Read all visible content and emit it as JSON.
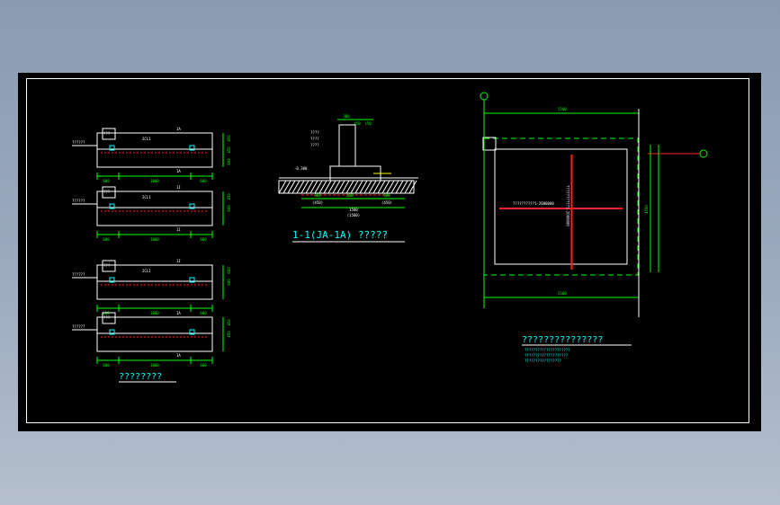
{
  "colors": {
    "background": "#000000",
    "line": "#ffffff",
    "dim": "#00ff00",
    "label": "#00ffff",
    "rebar": "#ff2020",
    "accent": "#ffff00"
  },
  "beams": [
    {
      "label_left": "??????",
      "tag_top": "???",
      "tag_mid": "2CL1",
      "axis_top": "1A",
      "axis_bottom": "1A",
      "dims_right": [
        "450",
        "450",
        "600"
      ],
      "dims_bottom": [
        "600",
        "3000",
        "600"
      ]
    },
    {
      "label_left": "??????",
      "tag_top": "???",
      "tag_mid": "2CL1",
      "axis_top": "1I",
      "axis_bottom": "1I",
      "dims_right": [
        "450",
        "600"
      ],
      "dims_bottom": [
        "600",
        "3000",
        "600"
      ]
    },
    {
      "label_left": "??????",
      "tag_top": "???",
      "tag_mid": "2CL1",
      "axis_top": "1I",
      "axis_bottom": "",
      "dims_right": [
        "600",
        "600"
      ],
      "dims_bottom": [
        "600",
        "3000",
        "600"
      ]
    },
    {
      "label_left": "??????",
      "tag_top": "???",
      "tag_mid": "",
      "axis_top": "1A",
      "axis_bottom": "1A",
      "dims_right": [
        "450",
        "450"
      ],
      "dims_bottom": [
        "600",
        "3000",
        "600"
      ]
    }
  ],
  "left_title": "????????",
  "section": {
    "title": "1-1(JA-1A) ?????",
    "dims_top": [
      "300",
      "450",
      "150"
    ],
    "dims_bottom": [
      "600",
      "400",
      "800"
    ],
    "dims_sub": [
      "(450)",
      "(450)"
    ],
    "total": "1500",
    "total_sub": "(1500)",
    "elev": "-0.300",
    "notes": [
      "????",
      "????",
      "????"
    ]
  },
  "plan": {
    "dim_top": "5100",
    "dim_bottom": "5100",
    "dim_right": "4500",
    "rebar_h": "??????????1-2000000",
    "rebar_v": "??????????1-2000000",
    "title": "???????????????",
    "notes": [
      "?????????????????????",
      "????????????????????",
      "?????????????????"
    ]
  }
}
